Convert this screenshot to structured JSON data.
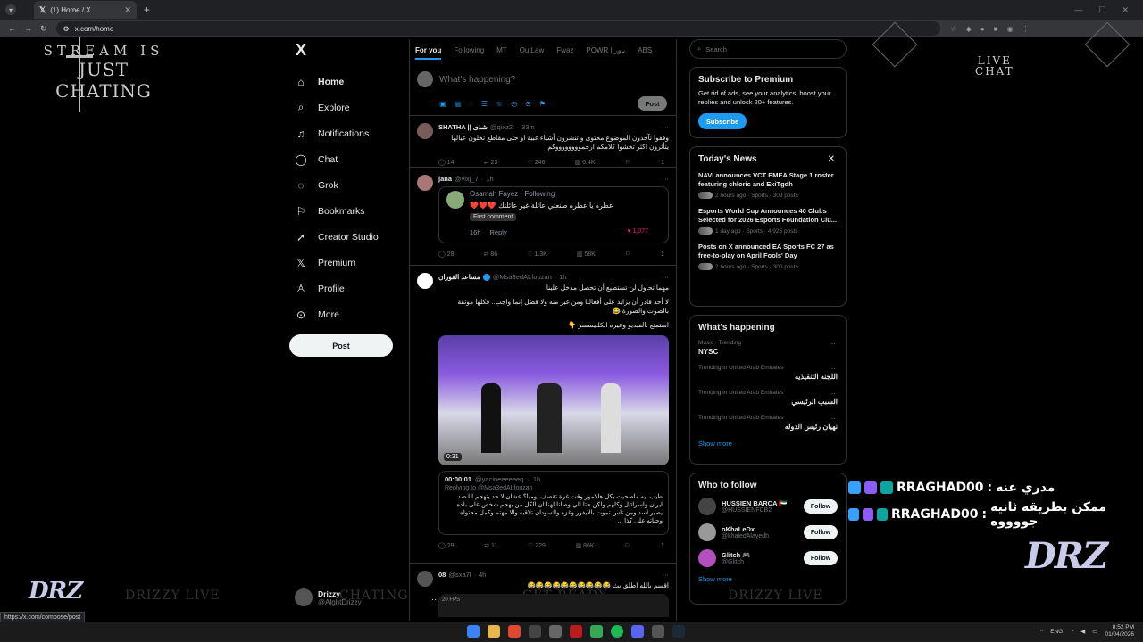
{
  "browser": {
    "tab_title": "(1) Home / X",
    "tab_icon": "x-logo-icon",
    "url": "x.com/home",
    "status_url": "https://x.com/compose/post"
  },
  "overlay": {
    "logo_line1": "STREAM IS",
    "logo_line2": "JUST CHATING",
    "live_chat_line1": "LIVE",
    "live_chat_line2": "CHAT",
    "chat": [
      {
        "user": "RRAGHAD00",
        "message": "مدري عنه"
      },
      {
        "user": "RRAGHAD00",
        "message": "ممكن بطريقه ثانيه جووووه"
      }
    ],
    "brand": "DRZ",
    "watermarks": [
      "DRIZZY LIVE",
      "CHATING",
      "GET READY",
      "DRIZZY LIVE"
    ]
  },
  "nav": {
    "logo": "X",
    "items": [
      {
        "label": "Home",
        "icon": "home-icon"
      },
      {
        "label": "Explore",
        "icon": "search-icon"
      },
      {
        "label": "Notifications",
        "icon": "bell-icon"
      },
      {
        "label": "Chat",
        "icon": "chat-icon"
      },
      {
        "label": "Grok",
        "icon": "grok-icon"
      },
      {
        "label": "Bookmarks",
        "icon": "bookmark-icon"
      },
      {
        "label": "Creator Studio",
        "icon": "rocket-icon"
      },
      {
        "label": "Premium",
        "icon": "x-premium-icon"
      },
      {
        "label": "Profile",
        "icon": "person-icon"
      },
      {
        "label": "More",
        "icon": "more-circle-icon"
      }
    ],
    "post_label": "Post",
    "profile": {
      "name": "Drizzy",
      "handle": "@AlghtDrizzy"
    }
  },
  "feed": {
    "tabs": [
      "For you",
      "Following",
      "MT",
      "OutLaw",
      "Fwaz",
      "POWR | باور",
      "ABS"
    ],
    "compose_placeholder": "What's happening?",
    "compose_post": "Post",
    "tweets": [
      {
        "name": "SHATHA || شذى",
        "handle": "@qixz2l",
        "time": "33m",
        "text": "وقفوا تآخذون الموضوع محتوى و تنشرون أشياء غبية او حتى مقاطع تخلون عيالها يتأثرون اكثر تخشوا كلامكم ارحمووووووووكم",
        "replies": "14",
        "reposts": "23",
        "likes": "246",
        "views": "6.4K"
      },
      {
        "name": "jana",
        "handle": "@vixj_7",
        "time": "1h",
        "quote": {
          "name": "Osamah Fayez",
          "following": "Following",
          "text": "عطره يا عطره صنعتي عائلة غير عائلتك ❤️❤️❤️",
          "badge": "First comment",
          "time": "16h",
          "reply": "Reply",
          "likes": "1,077"
        },
        "replies": "28",
        "reposts": "86",
        "likes": "1.3K",
        "views": "58K"
      },
      {
        "name": "مساعد الفوزان",
        "handle": "@Msa3edALfouzan",
        "time": "1h",
        "text1": "مهما تحاول لن تستطيع أن تحصل مدخل علينا",
        "text2": "لا أحد قادر أن يزايد على أفعالنا ومن غير منه ولا فضل إنما واجب.. فكلها موثقة بالصوت والصورة 😂",
        "text3": "استمتع بالفيديو وعيره الكلنيسسر 👇",
        "video_duration": "0:31",
        "reply": {
          "name": "00:00:01",
          "handle": "@yacineeeeeeq",
          "time": "1h",
          "replying_to": "Replying to @Msa3edALfouzan",
          "text": "طيب ليه ماضحيت بكل هالامور وقت غزة تقصف يوميا؟ عشان لا حد يتهجم انا ضد ايران واسرائيل وكلهم ولكن حتا الي وصلنا لهنا ان الكل من يهجم شخص على بلده يصير اسد ومن ناس تموت بالايفور وغزه والسودان تلاقيه والا مهتم وكمل محتواه وحياته على كذا ..."
        },
        "replies": "29",
        "reposts": "11",
        "likes": "229",
        "views": "86K"
      },
      {
        "name": "08",
        "handle": "@sxa7l",
        "time": "4h",
        "text": "اقسم بالله اطلق بث 😂😂😂😂😂😂😂😂😂😂",
        "thumb_text": "20 FPS"
      }
    ]
  },
  "right": {
    "search_placeholder": "Search",
    "premium": {
      "title": "Subscribe to Premium",
      "text": "Get rid of ads, see your analytics, boost your replies and unlock 20+ features.",
      "button": "Subscribe"
    },
    "news": {
      "title": "Today's News",
      "items": [
        {
          "title": "NAVI announces VCT EMEA Stage 1 roster featuring chloric and ExiTgdh",
          "meta": "2 hours ago · Sports · 309 posts"
        },
        {
          "title": "Esports World Cup Announces 40 Clubs Selected for 2026 Esports Foundation Clu...",
          "meta": "1 day ago · Sports · 4,925 posts"
        },
        {
          "title": "Posts on X announced EA Sports FC 27 as free-to-play on April Fools' Day",
          "meta": "2 hours ago · Sports · 300 posts"
        }
      ]
    },
    "happening": {
      "title": "What's happening",
      "trends": [
        {
          "context": "Music · Trending",
          "name": "NYSC"
        },
        {
          "context": "Trending in United Arab Emirates",
          "name": "اللجنه التنفيذيه"
        },
        {
          "context": "Trending in United Arab Emirates",
          "name": "السبب الرئيسي"
        },
        {
          "context": "Trending in United Arab Emirates",
          "name": "نهيان رئيس الدوله"
        }
      ],
      "show_more": "Show more"
    },
    "follow": {
      "title": "Who to follow",
      "users": [
        {
          "name": "HUSSIEN BARCA 🇦🇪",
          "handle": "@HUSSIENFCB2",
          "button": "Follow"
        },
        {
          "name": "oKhaLeDx",
          "handle": "@khaledAlayedh",
          "button": "Follow"
        },
        {
          "name": "Glitch 🎮",
          "handle": "@Glitch",
          "button": "Follow"
        }
      ],
      "show_more": "Show more"
    }
  },
  "taskbar": {
    "lang": "ENG",
    "time": "8:52 PM",
    "date": "01/04/2026"
  }
}
